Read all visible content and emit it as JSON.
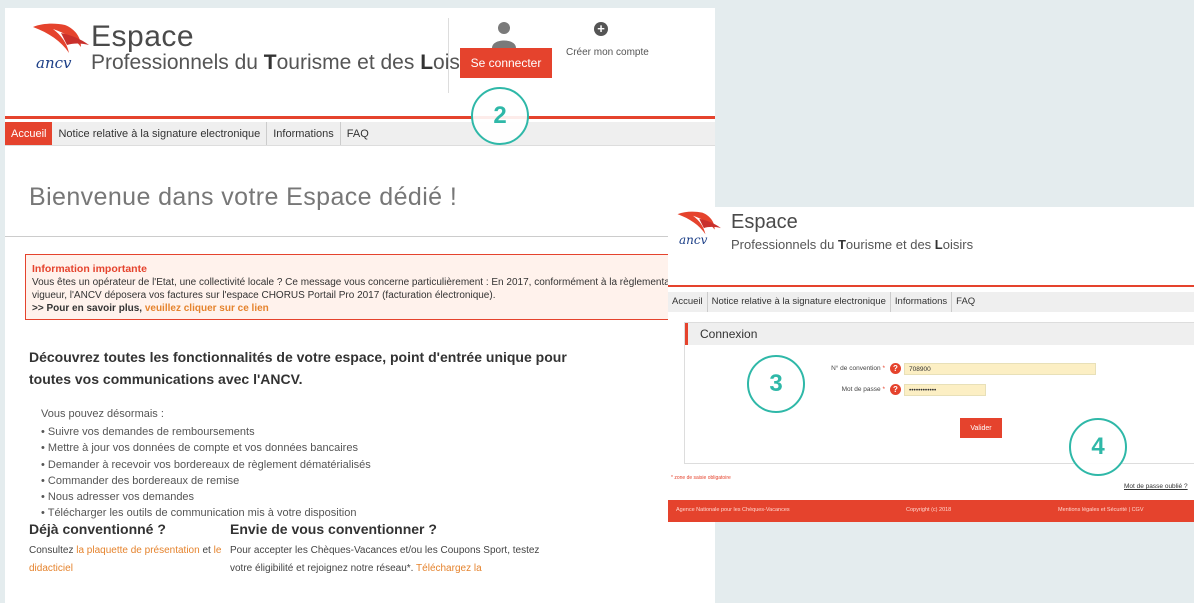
{
  "left_page": {
    "logo_text": "ancv",
    "brand_title": "Espace",
    "brand_subtitle_parts": [
      "Professionnels du ",
      "T",
      "ourisme et des ",
      "L",
      "oisirs"
    ],
    "connect_button": "Se connecter",
    "create_account": "Créer mon compte",
    "nav": [
      "Accueil",
      "Notice relative à la signature electronique",
      "Informations",
      "FAQ"
    ],
    "welcome": "Bienvenue dans votre Espace dédié !",
    "info": {
      "title": "Information importante",
      "body": "Vous êtes un opérateur de l'Etat, une collectivité locale ? Ce message vous concerne particulièrement : En 2017, conformément à la règlementation en vigueur, l'ANCV déposera vos factures sur l'espace CHORUS Portail Pro 2017 (facturation électronique).",
      "more_prefix": ">> Pour en savoir plus, ",
      "more_link": "veuillez cliquer sur ce lien"
    },
    "discover": "Découvrez toutes les fonctionnalités de votre espace, point d'entrée unique pour toutes vos communications avec l'ANCV.",
    "features_intro": "Vous pouvez désormais :",
    "features": [
      "Suivre vos demandes de remboursements",
      "Mettre à jour vos données de compte et vos données bancaires",
      "Demander à recevoir vos bordereaux de règlement dématérialisés",
      "Commander des bordereaux de remise",
      "Nous adresser vos demandes",
      "Télécharger les outils de communication mis à votre disposition"
    ],
    "col1": {
      "title": "Déjà conventionné ?",
      "text_prefix": "Consultez ",
      "link1": "la plaquette de présentation",
      "text_mid": " et ",
      "link2": "le didacticiel"
    },
    "col2": {
      "title": "Envie de vous conventionner ?",
      "text": "Pour accepter les Chèques-Vacances et/ou les Coupons Sport, testez votre éligibilité et rejoignez notre réseau*. ",
      "link": "Téléchargez la"
    }
  },
  "right_page": {
    "logo_text": "ancv",
    "brand_title": "Espace",
    "brand_subtitle_parts": [
      "Professionnels du ",
      "T",
      "ourisme et des ",
      "L",
      "oisirs"
    ],
    "nav": [
      "Accueil",
      "Notice relative à la signature electronique",
      "Informations",
      "FAQ"
    ],
    "connexion_title": "Connexion",
    "convention_label": "N° de convention",
    "convention_value": "708900",
    "password_label": "Mot de passe",
    "password_value": "••••••••••••",
    "required_mark": "*",
    "help_glyph": "?",
    "valider_button": "Valider",
    "required_note": "* zone de saisie obligatoire",
    "forgot_password": "Mot de passe oublié ?",
    "footer": [
      "Agence Nationale pour les Chèques-Vacances",
      "Copyright (c) 2018",
      "Mentions légales et Sécurité | CGV"
    ]
  },
  "steps": [
    "2",
    "3",
    "4"
  ],
  "colors": {
    "accent": "#e5432d",
    "teal": "#2fb8a8",
    "link_orange": "#e5832d",
    "brand_blue": "#1c3f87"
  }
}
